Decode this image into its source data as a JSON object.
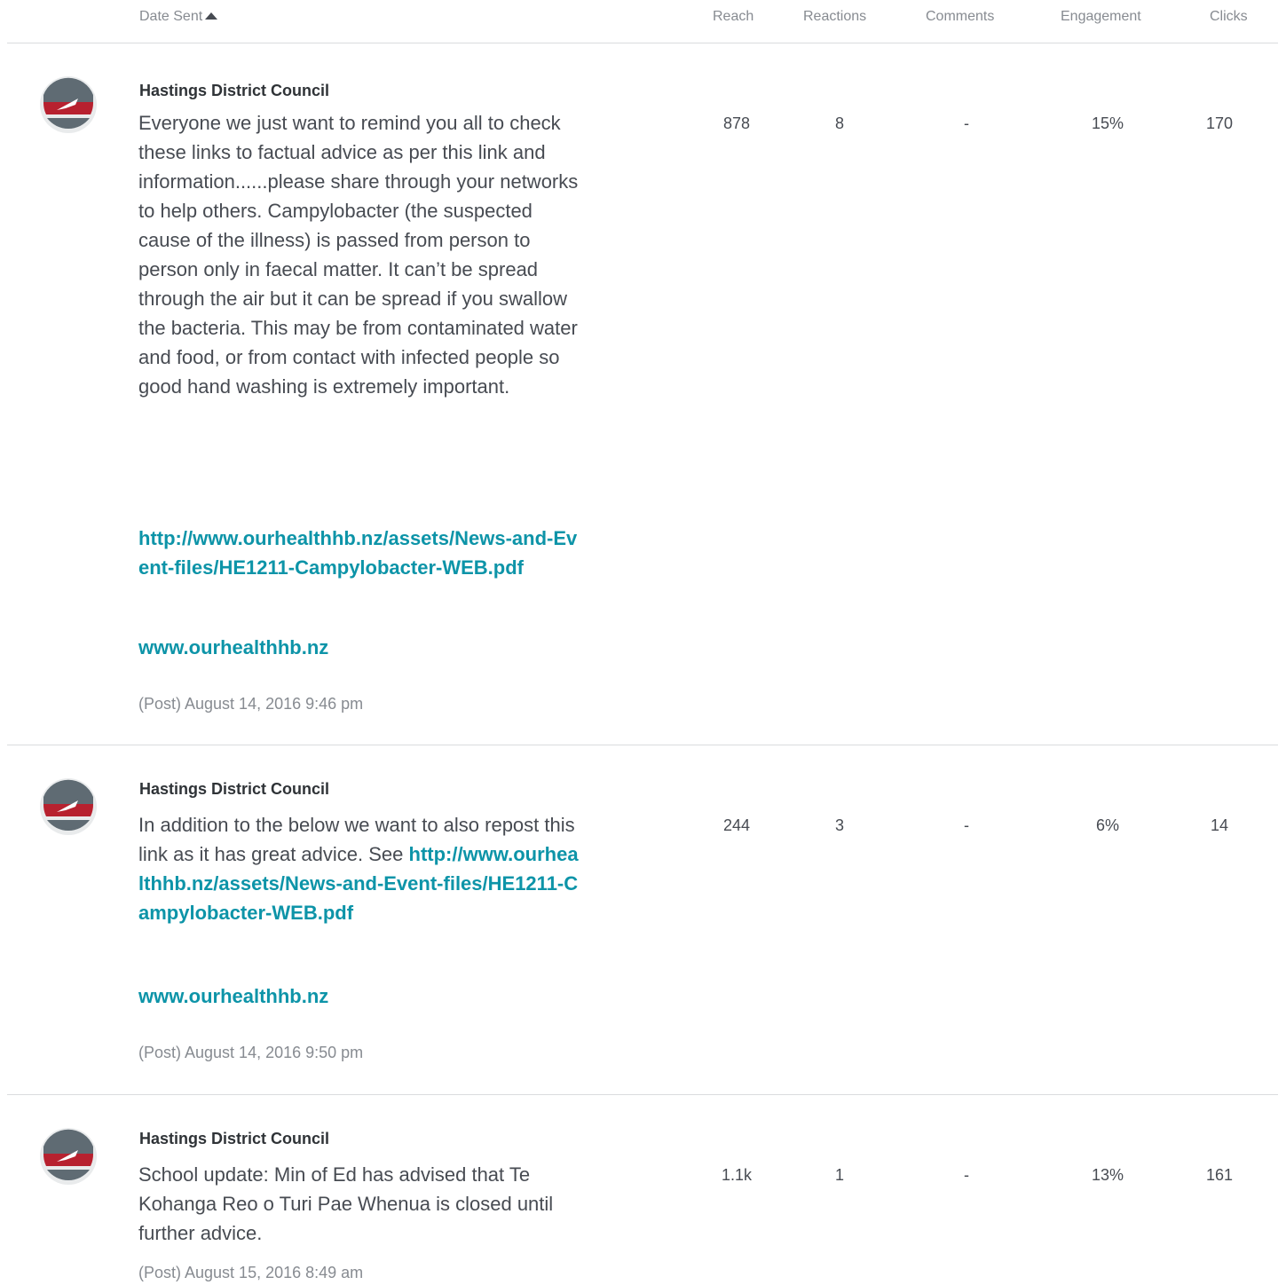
{
  "header": {
    "date_sent": "Date Sent",
    "reach": "Reach",
    "reactions": "Reactions",
    "comments": "Comments",
    "engagement": "Engagement",
    "clicks": "Clicks"
  },
  "posts": [
    {
      "author": "Hastings District Council",
      "body": "Everyone we just want to remind you all to check these links to factual advice as per this link and information......please share through your networks to help others. Campylobacter (the suspected cause of the illness) is passed from person to person only in faecal matter. It can’t be spread through the air but it can be spread if you swallow the bacteria. This may be from contaminated water and food, or from contact with infected people so good hand washing is extremely important.",
      "link1": "http://www.ourhealthhb.nz/assets/News-and-Event-files/HE1211-Campylobacter-WEB.pdf",
      "link2": "www.ourhealthhb.nz",
      "meta": "(Post) August 14, 2016 9:46 pm",
      "reach": "878",
      "reactions": "8",
      "comments": "-",
      "engagement": "15%",
      "clicks": "170"
    },
    {
      "author": "Hastings District Council",
      "body": "In addition to the below we want to also repost this link as it has great advice. See",
      "link1": "http://www.ourhealthhb.nz/assets/News-and-Event-files/HE1211-Campylobacter-WEB.pdf",
      "link2": "www.ourhealthhb.nz",
      "meta": "(Post) August 14, 2016 9:50 pm",
      "reach": "244",
      "reactions": "3",
      "comments": "-",
      "engagement": "6%",
      "clicks": "14"
    },
    {
      "author": "Hastings District Council",
      "body": "School update: Min of Ed has advised that Te Kohanga Reo o Turi Pae Whenua is closed until further advice.",
      "meta": "(Post) August 15, 2016 8:49 am",
      "reach": "1.1k",
      "reactions": "1",
      "comments": "-",
      "engagement": "13%",
      "clicks": "161"
    }
  ],
  "colors": {
    "link": "#0d94a8",
    "avatar_red": "#b7212f",
    "avatar_slate": "#5f6b73"
  }
}
